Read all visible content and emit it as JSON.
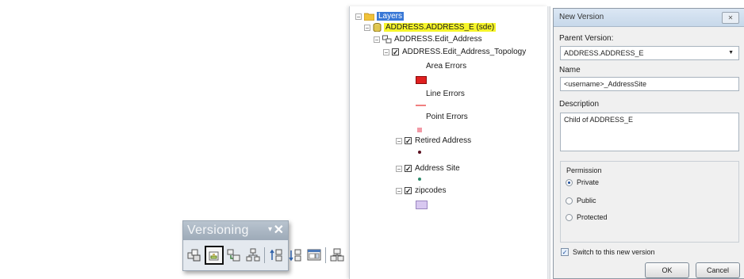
{
  "toolbar": {
    "title": "Versioning",
    "menu_glyph": "▾",
    "close_glyph": "✕",
    "buttons": [
      {
        "icon": "replicate-icon"
      },
      {
        "icon": "create-version-icon",
        "active": true
      },
      {
        "icon": "refresh-version-icon"
      },
      {
        "icon": "change-version-icon"
      },
      {
        "icon": "reconcile-icon"
      },
      {
        "icon": "post-icon"
      },
      {
        "icon": "version-changes-icon"
      },
      {
        "icon": "conflicts-icon"
      }
    ]
  },
  "toc": {
    "root_label": "Layers",
    "db_label": "ADDRESS.ADDRESS_E (sde)",
    "dataset_label": "ADDRESS.Edit_Address",
    "topology_label": "ADDRESS.Edit_Address_Topology",
    "area_errors": "Area Errors",
    "line_errors": "Line Errors",
    "point_errors": "Point Errors",
    "retired_label": "Retired Address",
    "site_label": "Address Site",
    "zip_label": "zipcodes",
    "check_glyph": "✓"
  },
  "dialog": {
    "title": "New Version",
    "close_glyph": "✕",
    "parent_label": "Parent Version:",
    "parent_value": "ADDRESS.ADDRESS_E",
    "name_label": "Name",
    "name_value": "<username>_AddressSite",
    "description_label": "Description",
    "description_value": "Child of ADDRESS_E",
    "permission_label": "Permission",
    "perm_private": "Private",
    "perm_public": "Public",
    "perm_protected": "Protected",
    "selected_permission": "Private",
    "switch_label": "Switch to this new version",
    "switch_checked": true,
    "ok_label": "OK",
    "cancel_label": "Cancel"
  },
  "colors": {
    "area_error": "#e02020",
    "line_error": "#f08080",
    "point_error": "#f29aa6",
    "retired_point": "#5a1020",
    "site_point": "#2e8b6b",
    "zip_fill": "#d8c8f0"
  }
}
